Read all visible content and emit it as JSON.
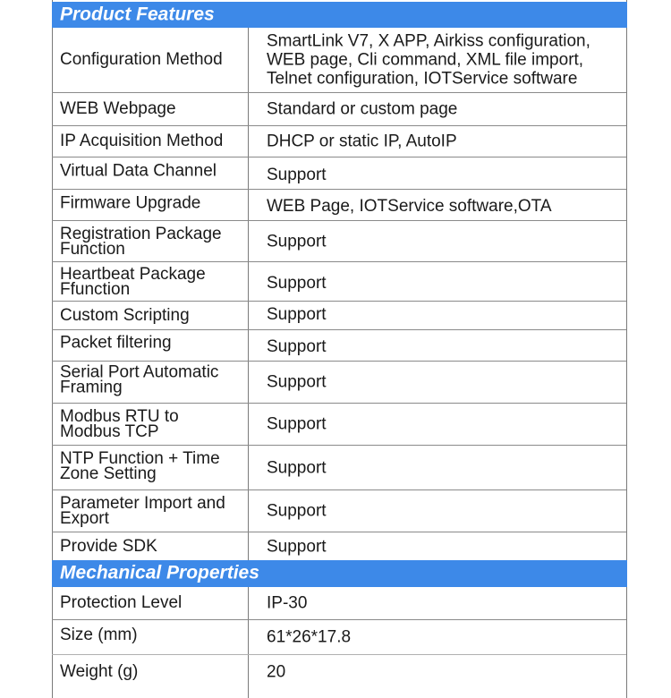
{
  "sections": [
    {
      "title": "Product Features",
      "rows": [
        {
          "key": "Configuration Method",
          "value": "SmartLink V7, X APP, Airkiss configuration, WEB page, Cli command, XML file import, Telnet configuration, IOTService software"
        },
        {
          "key": "WEB Webpage",
          "value": "Standard or custom page"
        },
        {
          "key": "IP Acquisition Method",
          "value": "DHCP or static IP, AutoIP"
        },
        {
          "key": "Virtual Data Channel",
          "value": "Support"
        },
        {
          "key": "Firmware Upgrade",
          "value": "WEB Page, IOTService software,OTA"
        },
        {
          "key": "Registration Package Function",
          "value": "Support"
        },
        {
          "key": "Heartbeat Package Ffunction",
          "value": "Support"
        },
        {
          "key": "Custom Scripting",
          "value": "Support"
        },
        {
          "key": "Packet filtering",
          "value": "Support"
        },
        {
          "key": "Serial Port Automatic Framing",
          "value": "Support"
        },
        {
          "key": "Modbus RTU to Modbus TCP",
          "value": "Support"
        },
        {
          "key": "NTP Function + Time Zone Setting",
          "value": "Support"
        },
        {
          "key": "Parameter Import and Export",
          "value": "Support"
        },
        {
          "key": "Provide SDK",
          "value": "Support"
        }
      ]
    },
    {
      "title": "Mechanical Properties",
      "rows": [
        {
          "key": "Protection Level",
          "value": "IP-30"
        },
        {
          "key": "Size (mm)",
          "value": "61*26*17.8"
        },
        {
          "key": "Weight (g)",
          "value": "20"
        }
      ]
    }
  ],
  "colors": {
    "section_header_bg": "#3d89e8",
    "section_header_text": "#ffffff",
    "border": "#8a8a8a"
  }
}
